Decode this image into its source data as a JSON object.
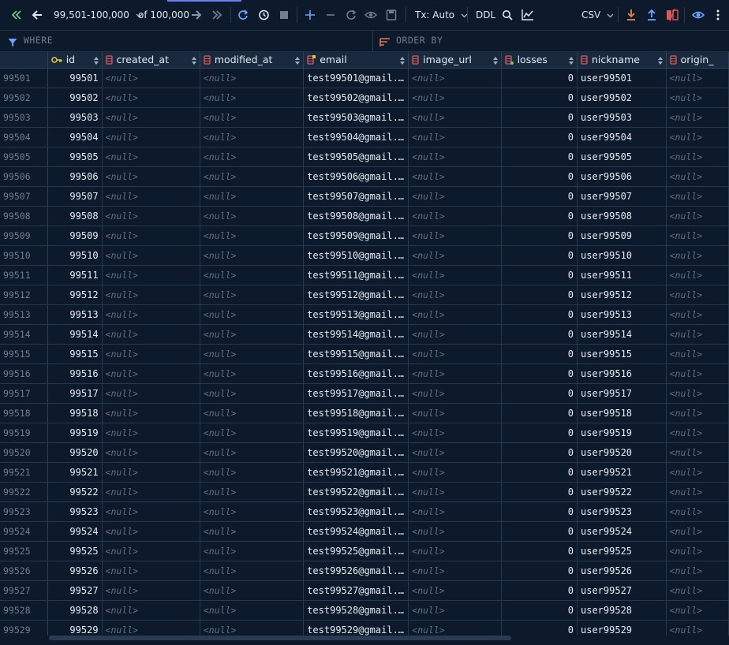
{
  "toolbar": {
    "range_label": "99,501-100,000",
    "of_label": "of 100,000",
    "tx_label": "Tx: Auto",
    "ddl_label": "DDL",
    "export_format": "CSV"
  },
  "filter": {
    "where_label": "WHERE",
    "order_label": "ORDER BY"
  },
  "columns": [
    {
      "label": "id"
    },
    {
      "label": "created_at"
    },
    {
      "label": "modified_at"
    },
    {
      "label": "email"
    },
    {
      "label": "image_url"
    },
    {
      "label": "losses"
    },
    {
      "label": "nickname"
    },
    {
      "label": "origin_"
    }
  ],
  "null_text": "<null>",
  "rows": [
    {
      "n": "99501",
      "id": "99501",
      "email": "test99501@gmail.…",
      "losses": "0",
      "nickname": "user99501"
    },
    {
      "n": "99502",
      "id": "99502",
      "email": "test99502@gmail.…",
      "losses": "0",
      "nickname": "user99502"
    },
    {
      "n": "99503",
      "id": "99503",
      "email": "test99503@gmail.…",
      "losses": "0",
      "nickname": "user99503"
    },
    {
      "n": "99504",
      "id": "99504",
      "email": "test99504@gmail.…",
      "losses": "0",
      "nickname": "user99504"
    },
    {
      "n": "99505",
      "id": "99505",
      "email": "test99505@gmail.…",
      "losses": "0",
      "nickname": "user99505"
    },
    {
      "n": "99506",
      "id": "99506",
      "email": "test99506@gmail.…",
      "losses": "0",
      "nickname": "user99506"
    },
    {
      "n": "99507",
      "id": "99507",
      "email": "test99507@gmail.…",
      "losses": "0",
      "nickname": "user99507"
    },
    {
      "n": "99508",
      "id": "99508",
      "email": "test99508@gmail.…",
      "losses": "0",
      "nickname": "user99508"
    },
    {
      "n": "99509",
      "id": "99509",
      "email": "test99509@gmail.…",
      "losses": "0",
      "nickname": "user99509"
    },
    {
      "n": "99510",
      "id": "99510",
      "email": "test99510@gmail.…",
      "losses": "0",
      "nickname": "user99510"
    },
    {
      "n": "99511",
      "id": "99511",
      "email": "test99511@gmail.…",
      "losses": "0",
      "nickname": "user99511"
    },
    {
      "n": "99512",
      "id": "99512",
      "email": "test99512@gmail.…",
      "losses": "0",
      "nickname": "user99512"
    },
    {
      "n": "99513",
      "id": "99513",
      "email": "test99513@gmail.…",
      "losses": "0",
      "nickname": "user99513"
    },
    {
      "n": "99514",
      "id": "99514",
      "email": "test99514@gmail.…",
      "losses": "0",
      "nickname": "user99514"
    },
    {
      "n": "99515",
      "id": "99515",
      "email": "test99515@gmail.…",
      "losses": "0",
      "nickname": "user99515"
    },
    {
      "n": "99516",
      "id": "99516",
      "email": "test99516@gmail.…",
      "losses": "0",
      "nickname": "user99516"
    },
    {
      "n": "99517",
      "id": "99517",
      "email": "test99517@gmail.…",
      "losses": "0",
      "nickname": "user99517"
    },
    {
      "n": "99518",
      "id": "99518",
      "email": "test99518@gmail.…",
      "losses": "0",
      "nickname": "user99518"
    },
    {
      "n": "99519",
      "id": "99519",
      "email": "test99519@gmail.…",
      "losses": "0",
      "nickname": "user99519"
    },
    {
      "n": "99520",
      "id": "99520",
      "email": "test99520@gmail.…",
      "losses": "0",
      "nickname": "user99520"
    },
    {
      "n": "99521",
      "id": "99521",
      "email": "test99521@gmail.…",
      "losses": "0",
      "nickname": "user99521"
    },
    {
      "n": "99522",
      "id": "99522",
      "email": "test99522@gmail.…",
      "losses": "0",
      "nickname": "user99522"
    },
    {
      "n": "99523",
      "id": "99523",
      "email": "test99523@gmail.…",
      "losses": "0",
      "nickname": "user99523"
    },
    {
      "n": "99524",
      "id": "99524",
      "email": "test99524@gmail.…",
      "losses": "0",
      "nickname": "user99524"
    },
    {
      "n": "99525",
      "id": "99525",
      "email": "test99525@gmail.…",
      "losses": "0",
      "nickname": "user99525"
    },
    {
      "n": "99526",
      "id": "99526",
      "email": "test99526@gmail.…",
      "losses": "0",
      "nickname": "user99526"
    },
    {
      "n": "99527",
      "id": "99527",
      "email": "test99527@gmail.…",
      "losses": "0",
      "nickname": "user99527"
    },
    {
      "n": "99528",
      "id": "99528",
      "email": "test99528@gmail.…",
      "losses": "0",
      "nickname": "user99528"
    },
    {
      "n": "99529",
      "id": "99529",
      "email": "test99529@gmail.…",
      "losses": "0",
      "nickname": "user99529"
    }
  ],
  "colors": {
    "background": "#0d1a2b",
    "header": "#1a2a3e",
    "accent": "#6b7ff0",
    "green": "#6fc27a",
    "key": "#e8c431",
    "column_icon": "#e0575b",
    "upload": "#6aa3f7"
  },
  "icons": {
    "first_page": "double-chevron-left-icon",
    "prev_page": "arrow-left-icon",
    "next_page": "arrow-right-icon",
    "last_page": "double-chevron-right-icon",
    "reload": "reload-icon",
    "history": "history-icon",
    "stop": "stop-icon",
    "add_row": "plus-icon",
    "delete_row": "minus-icon",
    "revert": "revert-icon",
    "preview": "eye-icon",
    "submit": "save-icon",
    "search": "search-icon",
    "chart": "chart-icon",
    "download": "download-icon",
    "upload": "upload-icon",
    "compare": "compare-icon",
    "view": "eye-icon",
    "more": "more-vertical-icon",
    "filter": "filter-icon",
    "sort": "sort-icon"
  }
}
